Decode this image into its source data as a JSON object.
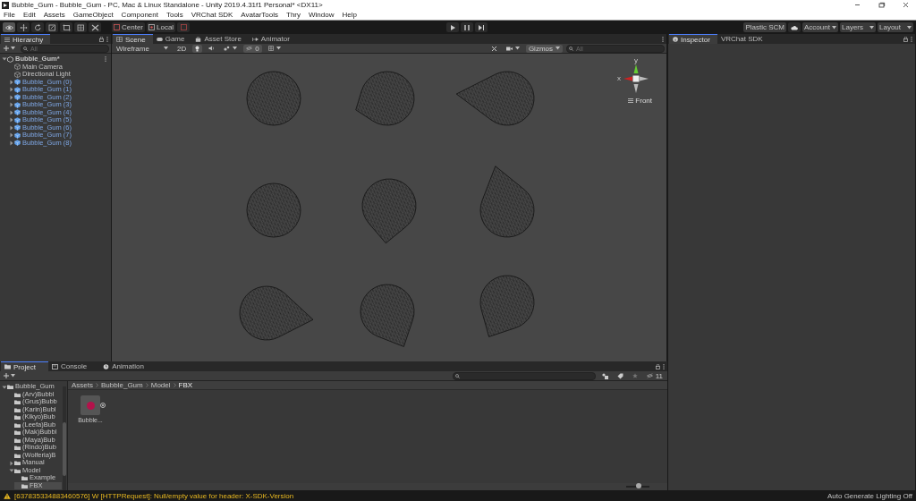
{
  "window": {
    "title": "Bubble_Gum - Bubble_Gum - PC, Mac & Linux Standalone - Unity 2019.4.31f1 Personal* <DX11>"
  },
  "menu": [
    "File",
    "Edit",
    "Assets",
    "GameObject",
    "Component",
    "Tools",
    "VRChat SDK",
    "AvatarTools",
    "Thry",
    "Window",
    "Help"
  ],
  "toolbar": {
    "tools": [
      {
        "kind": "view",
        "selected": true
      },
      {
        "kind": "move",
        "selected": false
      },
      {
        "kind": "rotate",
        "selected": false
      },
      {
        "kind": "scale",
        "selected": false
      },
      {
        "kind": "rect",
        "selected": false
      },
      {
        "kind": "transform",
        "selected": false
      },
      {
        "kind": "custom",
        "selected": false
      }
    ],
    "pivot": "Center",
    "space": "Local",
    "plastic": "Plastic SCM",
    "dropdowns": [
      "Account",
      "Layers",
      "Layout"
    ]
  },
  "hierarchy": {
    "tab": "Hierarchy",
    "placeholder": "All",
    "items": [
      {
        "label": "Bubble_Gum*",
        "kind": "scene",
        "expanded": true,
        "children": [
          {
            "label": "Main Camera",
            "kind": "object"
          },
          {
            "label": "Directional Light",
            "kind": "object"
          },
          {
            "label": "Bubble_Gum (0)",
            "kind": "prefab",
            "expanded": false
          },
          {
            "label": "Bubble_Gum (1)",
            "kind": "prefab",
            "expanded": false
          },
          {
            "label": "Bubble_Gum (2)",
            "kind": "prefab",
            "expanded": false
          },
          {
            "label": "Bubble_Gum (3)",
            "kind": "prefab",
            "expanded": false
          },
          {
            "label": "Bubble_Gum (4)",
            "kind": "prefab",
            "expanded": false
          },
          {
            "label": "Bubble_Gum (5)",
            "kind": "prefab",
            "expanded": false
          },
          {
            "label": "Bubble_Gum (6)",
            "kind": "prefab",
            "expanded": false
          },
          {
            "label": "Bubble_Gum (7)",
            "kind": "prefab",
            "expanded": false
          },
          {
            "label": "Bubble_Gum (8)",
            "kind": "prefab",
            "expanded": false
          }
        ]
      }
    ]
  },
  "scene_view": {
    "tabs": [
      {
        "label": "Scene",
        "selected": true
      },
      {
        "label": "Game",
        "selected": false
      },
      {
        "label": "Asset Store",
        "selected": false
      },
      {
        "label": "Animator",
        "selected": false
      }
    ],
    "draw_mode": "Wireframe",
    "mode_2d": "2D",
    "hidden_count": "0",
    "gizmos": "Gizmos",
    "placeholder": "All",
    "axis_y": "y",
    "axis_x": "x",
    "view_label": "Front",
    "meshes": [
      {
        "kind": "sphere"
      },
      {
        "kind": "tip-left"
      },
      {
        "kind": "tail-left"
      },
      {
        "kind": "sphere"
      },
      {
        "kind": "tail-down"
      },
      {
        "kind": "tail-up"
      },
      {
        "kind": "tail-right"
      },
      {
        "kind": "tail-down-right"
      },
      {
        "kind": "tail-down-left"
      }
    ]
  },
  "inspector": {
    "tabs": [
      {
        "label": "Inspector",
        "selected": true
      },
      {
        "label": "VRChat SDK",
        "selected": false
      }
    ]
  },
  "project": {
    "tabs": [
      {
        "label": "Project",
        "selected": true
      },
      {
        "label": "Console",
        "selected": false
      },
      {
        "label": "Animation",
        "selected": false
      }
    ],
    "tree": [
      {
        "label": "Bubble_Gum",
        "expanded": true,
        "selected": false,
        "children": [
          {
            "label": "(Arv)Bubbl",
            "selected": false
          },
          {
            "label": "(Grus)Bubb",
            "selected": false
          },
          {
            "label": "(Karin)Bubl",
            "selected": false
          },
          {
            "label": "(Kikyo)Bub",
            "selected": false
          },
          {
            "label": "(Leefa)Bub",
            "selected": false
          },
          {
            "label": "(Mak)Bubbl",
            "selected": false
          },
          {
            "label": "(Maya)Bub",
            "selected": false
          },
          {
            "label": "(Rindo)Bub",
            "selected": false
          },
          {
            "label": "(Wolferia)B",
            "selected": false
          },
          {
            "label": "Manual",
            "expanded": false,
            "selected": false
          },
          {
            "label": "Model",
            "expanded": true,
            "selected": false,
            "children": [
              {
                "label": "Example",
                "selected": false
              },
              {
                "label": "FBX",
                "selected": true
              }
            ]
          }
        ]
      }
    ],
    "breadcrumb": [
      "Assets",
      "Bubble_Gum",
      "Model",
      "FBX"
    ],
    "hidden_count": "11",
    "assets": [
      {
        "label": "Bubble..."
      }
    ],
    "zoom": {
      "level": 0.55
    }
  },
  "status_bar": {
    "message": "[637835334883460576] W [HTTPRequest]: Null/empty value for header: X-SDK-Version",
    "lighting": "Auto Generate Lighting Off"
  }
}
